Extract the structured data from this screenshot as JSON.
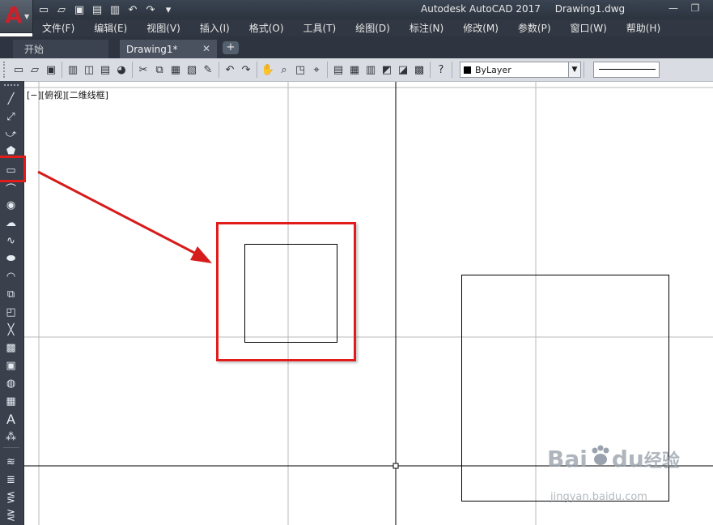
{
  "app": {
    "logo_letter": "A",
    "title": "Autodesk AutoCAD 2017",
    "file": "Drawing1.dwg"
  },
  "quick_access": [
    "new-icon",
    "open-icon",
    "save-icon",
    "save-as-icon",
    "print-icon",
    "undo-icon",
    "redo-icon",
    "customize-icon"
  ],
  "menu": [
    "文件(F)",
    "编辑(E)",
    "视图(V)",
    "插入(I)",
    "格式(O)",
    "工具(T)",
    "绘图(D)",
    "标注(N)",
    "修改(M)",
    "参数(P)",
    "窗口(W)",
    "帮助(H)"
  ],
  "tabs": {
    "start": "开始",
    "active": "Drawing1*",
    "add": "+"
  },
  "toolbar": {
    "layer_value": "ByLayer"
  },
  "viewport": {
    "label": "[−][俯视][二维线框]"
  },
  "colors": {
    "highlight": "#e21b1b",
    "grid": "#b9b9b9",
    "axis": "#000000",
    "drawing_bg": "#ffffff"
  },
  "watermark": {
    "brand_letters": "Bai",
    "brand_tail": "du",
    "suffix": "经验",
    "sub": "jingyan.baidu.com"
  }
}
